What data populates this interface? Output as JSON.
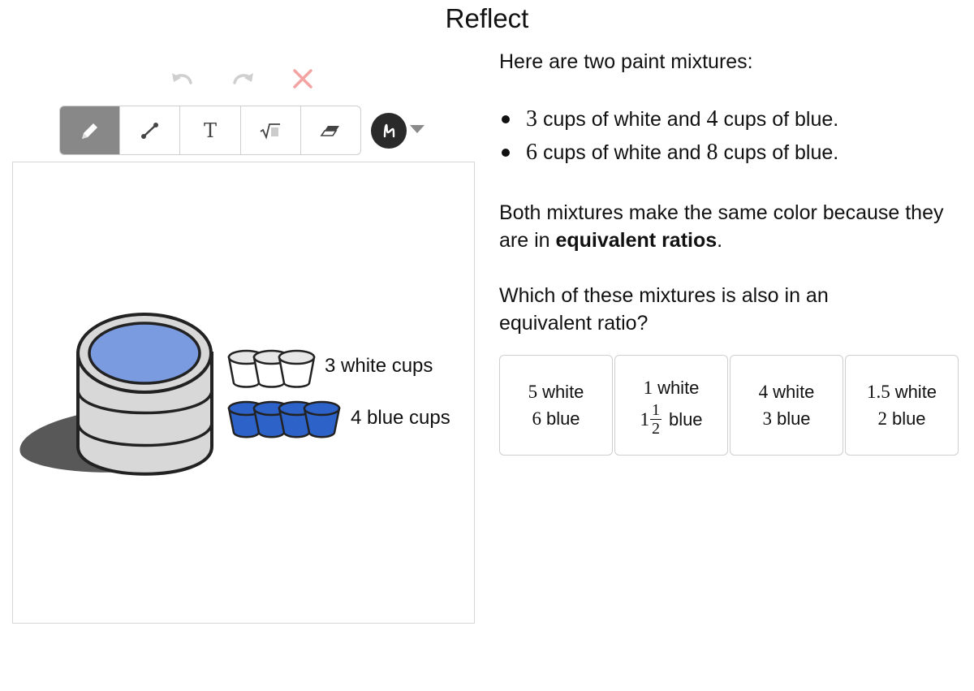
{
  "page": {
    "title": "Reflect"
  },
  "icons": {
    "undo": "undo-icon",
    "redo": "redo-icon",
    "clear": "close-icon",
    "pen": "pencil-icon",
    "line": "line-icon",
    "text": "T",
    "math": "√",
    "eraser": "eraser-icon",
    "color": "pen-stroke-icon",
    "caret": "caret-down-icon"
  },
  "colors": {
    "active_tool": "#888888",
    "paint_blue": "#7b9be0",
    "cup_blue": "#2d63c8",
    "bucket_gray": "#d9d9d9",
    "shadow": "#555555",
    "clear_red": "#f4a3a3"
  },
  "canvas": {
    "white_cups_label": "3 white cups",
    "blue_cups_label": "4 blue cups"
  },
  "prompt": {
    "intro": "Here are two paint mixtures:",
    "mixtures": [
      {
        "white": "3",
        "white_text": "cups of white and",
        "blue": "4",
        "blue_text": "cups of blue."
      },
      {
        "white": "6",
        "white_text": "cups of white and",
        "blue": "8",
        "blue_text": "cups of blue."
      }
    ],
    "explain_before": "Both mixtures make the same color because they are in ",
    "explain_bold": "equivalent ratios",
    "explain_after": ".",
    "question": "Which of these mixtures is also in an equivalent ratio?"
  },
  "choices": [
    {
      "white_num": "5",
      "white_label": "white",
      "blue_num": "6",
      "blue_label": "blue"
    },
    {
      "white_num": "1",
      "white_label": "white",
      "blue_whole": "1",
      "blue_frac_num": "1",
      "blue_frac_den": "2",
      "blue_label": "blue"
    },
    {
      "white_num": "4",
      "white_label": "white",
      "blue_num": "3",
      "blue_label": "blue"
    },
    {
      "white_num": "1.5",
      "white_label": "white",
      "blue_num": "2",
      "blue_label": "blue"
    }
  ]
}
